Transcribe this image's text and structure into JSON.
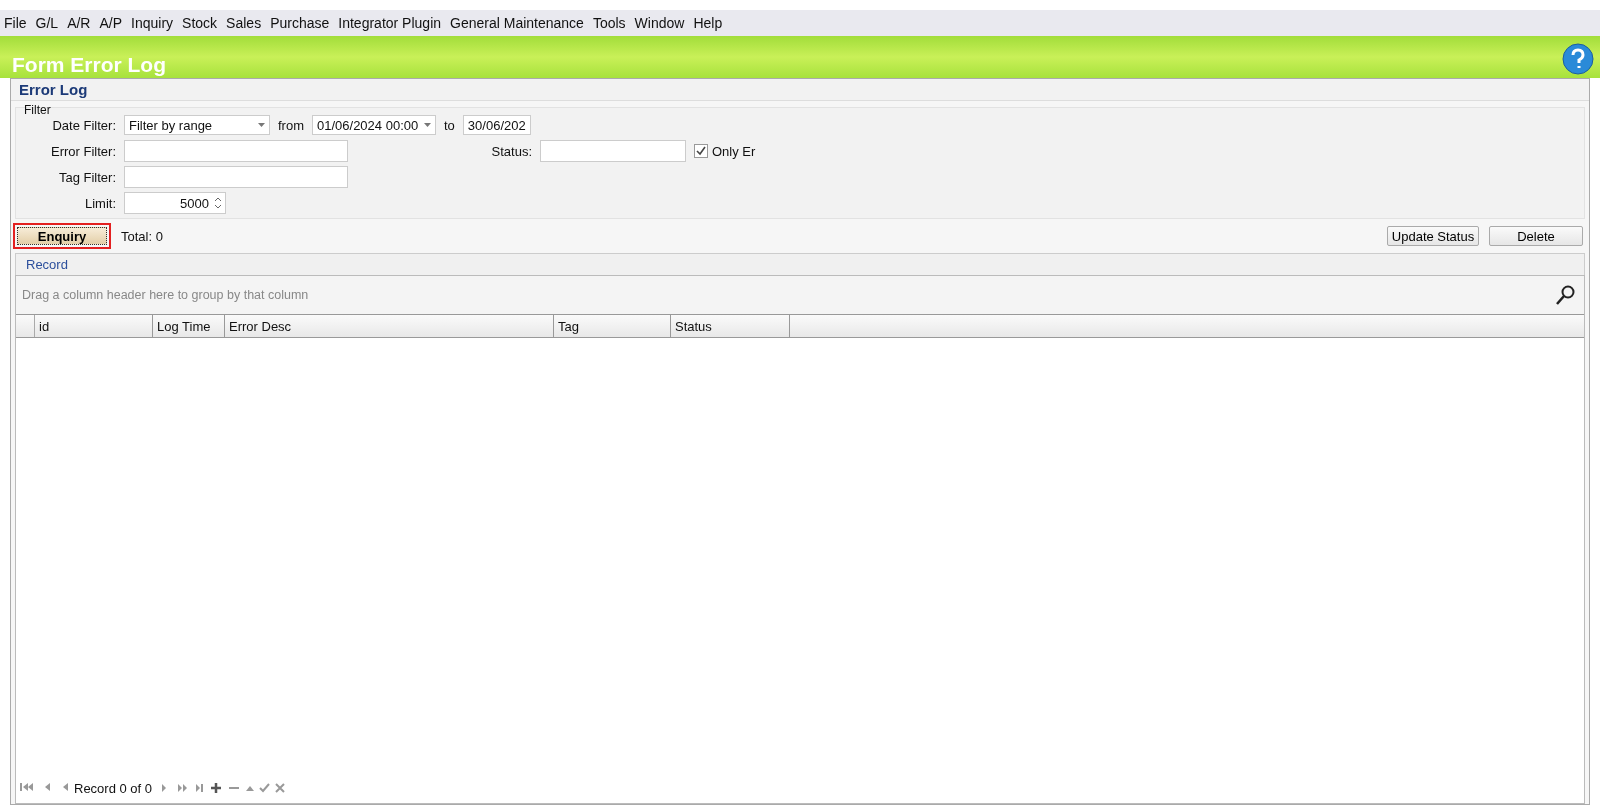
{
  "menu": [
    "File",
    "G/L",
    "A/R",
    "A/P",
    "Inquiry",
    "Stock",
    "Sales",
    "Purchase",
    "Integrator Plugin",
    "General Maintenance",
    "Tools",
    "Window",
    "Help"
  ],
  "header": {
    "title": "Form Error Log"
  },
  "panel": {
    "title": "Error Log"
  },
  "filter": {
    "legend": "Filter",
    "date_filter_label": "Date Filter:",
    "date_filter_value": "Filter by range",
    "from_label": "from",
    "from_value": "01/06/2024 00:00",
    "to_label": "to",
    "to_value": "30/06/202",
    "error_filter_label": "Error Filter:",
    "status_label": "Status:",
    "only_errors": {
      "label": "Only Er",
      "checked": true
    },
    "tag_filter_label": "Tag Filter:",
    "limit_label": "Limit:",
    "limit_value": "5000"
  },
  "toolbar": {
    "enquiry": {
      "label": "Enquiry",
      "highlighted": true
    },
    "total": "Total: 0",
    "update_status": "Update Status",
    "delete": "Delete"
  },
  "record_tab": "Record",
  "grid": {
    "group_hint": "Drag a column header here to group by that column",
    "columns": [
      "id",
      "Log Time",
      "Error Desc",
      "Tag",
      "Status"
    ]
  },
  "navigator": {
    "record_text": "Record 0 of 0"
  }
}
